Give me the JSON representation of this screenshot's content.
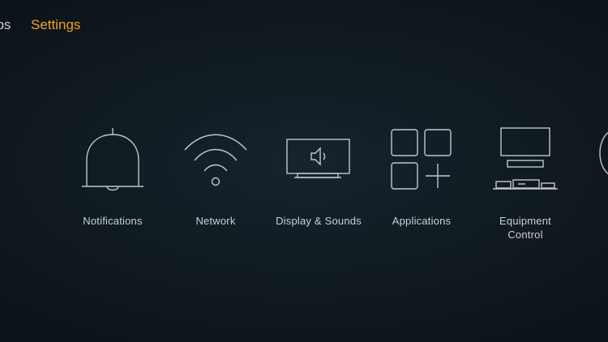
{
  "nav": {
    "items": [
      {
        "label": "Apps",
        "visible_text": "pps"
      },
      {
        "label": "Settings"
      }
    ]
  },
  "colors": {
    "accent": "#f0a028",
    "text": "#c9d1d6",
    "icon_stroke": "#bfc7cc",
    "background": "#111c23"
  },
  "settings": {
    "items": [
      {
        "label": "Notifications",
        "icon": "bell-icon"
      },
      {
        "label": "Network",
        "icon": "wifi-icon"
      },
      {
        "label": "Display & Sounds",
        "icon": "tv-icon"
      },
      {
        "label": "Applications",
        "icon": "apps-grid-icon"
      },
      {
        "label": "Equipment\nControl",
        "icon": "equipment-icon"
      }
    ]
  }
}
